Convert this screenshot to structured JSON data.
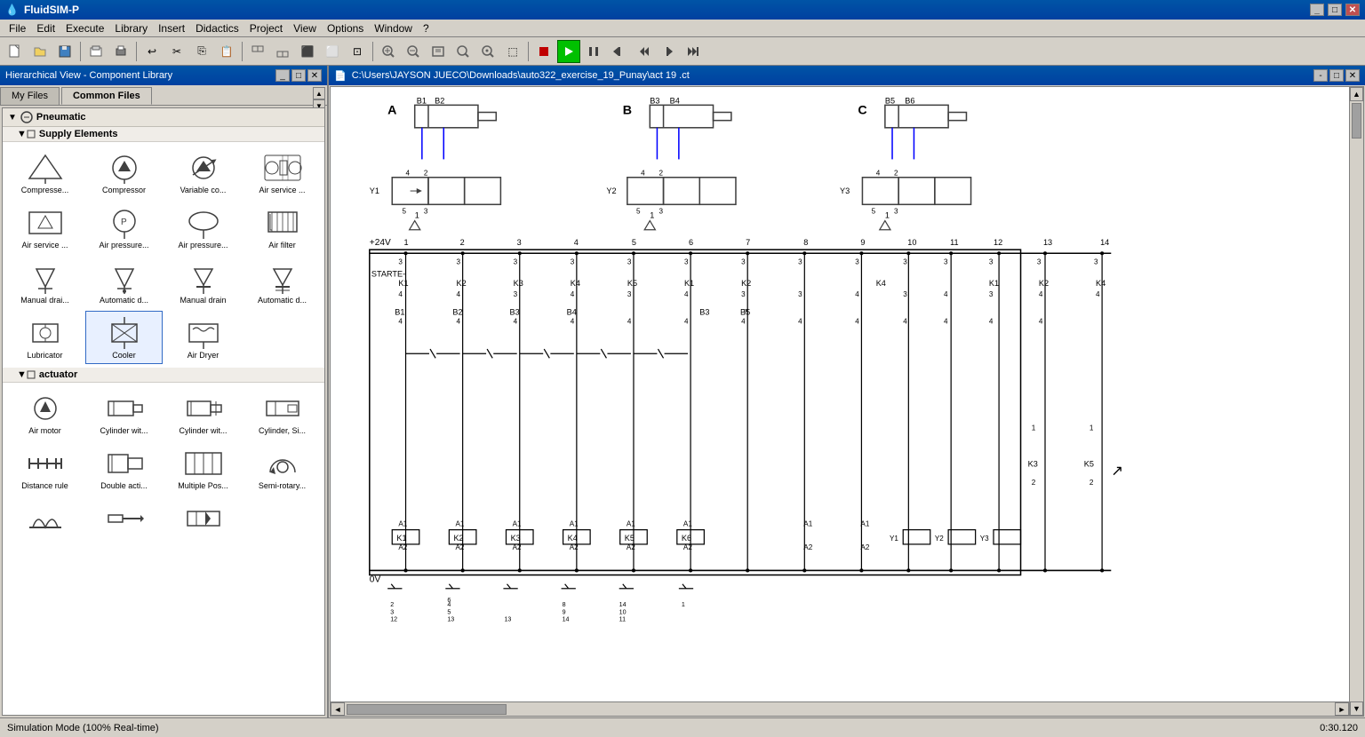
{
  "titleBar": {
    "title": "FluidSIM-P",
    "icon": "🔵",
    "controls": [
      "_",
      "□",
      "✕"
    ]
  },
  "menuBar": {
    "items": [
      "File",
      "Edit",
      "Execute",
      "Library",
      "Insert",
      "Didactics",
      "Project",
      "View",
      "Options",
      "Window",
      "?"
    ]
  },
  "toolbar": {
    "buttons": [
      {
        "name": "new",
        "icon": "📄"
      },
      {
        "name": "open",
        "icon": "📂"
      },
      {
        "name": "save",
        "icon": "💾"
      },
      {
        "name": "print-preview",
        "icon": "🖨"
      },
      {
        "name": "print",
        "icon": "🖨"
      },
      {
        "name": "undo",
        "icon": "↩"
      },
      {
        "name": "cut",
        "icon": "✂"
      },
      {
        "name": "copy",
        "icon": "⎘"
      },
      {
        "name": "paste",
        "icon": "📋"
      },
      {
        "name": "align-left",
        "icon": "⬛"
      },
      {
        "name": "align-center",
        "icon": "⬛"
      },
      {
        "name": "align-right",
        "icon": "⬛"
      },
      {
        "name": "align-top",
        "icon": "⬛"
      },
      {
        "name": "align-bottom",
        "icon": "⬛"
      },
      {
        "name": "zoom-in",
        "icon": "🔍"
      },
      {
        "name": "zoom-out",
        "icon": "🔍"
      },
      {
        "name": "zoom-fit",
        "icon": "⊞"
      },
      {
        "name": "zoom-actual",
        "icon": "⊡"
      },
      {
        "name": "stop",
        "icon": "⬛"
      },
      {
        "name": "play",
        "icon": "▶"
      },
      {
        "name": "pause",
        "icon": "⏸"
      },
      {
        "name": "step-back",
        "icon": "⏮"
      },
      {
        "name": "step-back2",
        "icon": "⏭"
      },
      {
        "name": "step-fwd",
        "icon": "⏭"
      },
      {
        "name": "fast-fwd",
        "icon": "⏭"
      }
    ]
  },
  "leftPanel": {
    "title": "Hierarchical View - Component Library",
    "tabs": [
      {
        "label": "My Files",
        "active": false
      },
      {
        "label": "Common Files",
        "active": true
      }
    ],
    "sections": [
      {
        "name": "Pneumatic",
        "expanded": true,
        "subsections": [
          {
            "name": "Supply Elements",
            "expanded": true,
            "components": [
              {
                "label": "Compresse...",
                "icon": "compressor-triangle"
              },
              {
                "label": "Compressor",
                "icon": "compressor-circle"
              },
              {
                "label": "Variable co...",
                "icon": "variable-comp"
              },
              {
                "label": "Air service ...",
                "icon": "air-service-combo"
              },
              {
                "label": "Air service ...",
                "icon": "air-service-rect"
              },
              {
                "label": "Air pressure...",
                "icon": "air-pressure-circle"
              },
              {
                "label": "Air pressure...",
                "icon": "air-pressure-oval"
              },
              {
                "label": "Air filter",
                "icon": "air-filter"
              },
              {
                "label": "Manual drai...",
                "icon": "manual-drain"
              },
              {
                "label": "Automatic d...",
                "icon": "auto-drain"
              },
              {
                "label": "Manual drain",
                "icon": "manual-drain2"
              },
              {
                "label": "Automatic d...",
                "icon": "auto-drain2"
              },
              {
                "label": "Lubricator",
                "icon": "lubricator"
              },
              {
                "label": "Cooler",
                "icon": "cooler"
              },
              {
                "label": "Air Dryer",
                "icon": "air-dryer"
              }
            ]
          },
          {
            "name": "actuator",
            "expanded": true,
            "components": [
              {
                "label": "Air motor",
                "icon": "air-motor"
              },
              {
                "label": "Cylinder wit...",
                "icon": "cylinder1"
              },
              {
                "label": "Cylinder wit...",
                "icon": "cylinder2"
              },
              {
                "label": "Cylinder, Si...",
                "icon": "cylinder3"
              },
              {
                "label": "Distance rule",
                "icon": "distance-rule"
              },
              {
                "label": "Double acti...",
                "icon": "double-acting"
              },
              {
                "label": "Multiple Pos...",
                "icon": "multiple-pos"
              },
              {
                "label": "Semi-rotary...",
                "icon": "semi-rotary"
              },
              {
                "label": "",
                "icon": "bellows"
              },
              {
                "label": "",
                "icon": "actuator2"
              },
              {
                "label": "",
                "icon": "actuator3"
              }
            ]
          }
        ]
      }
    ]
  },
  "canvas": {
    "title": "C:\\Users\\JAYSON JUECO\\Downloads\\auto322_exercise_19_Punay\\act 19 .ct",
    "controls": [
      "-",
      "□",
      "✕"
    ]
  },
  "statusBar": {
    "mode": "Simulation Mode (100% Real-time)",
    "time": "0:30.120"
  },
  "diagram": {
    "labels": {
      "A": "A",
      "B": "B",
      "C": "C",
      "Y1": "Y1",
      "Y2": "Y2",
      "Y3": "Y3",
      "plus24V": "+24V",
      "zero": "0V",
      "starter": "STARTE-",
      "coils": [
        "K1",
        "K2",
        "K3",
        "K4",
        "K5",
        "K1",
        "K2",
        "K4"
      ],
      "contacts": [
        "B1",
        "B2",
        "B3",
        "B4",
        "B5",
        "B6"
      ],
      "relays": [
        "K1",
        "K2",
        "K3",
        "K4",
        "K5",
        "K6"
      ],
      "valves": [
        "Y1",
        "Y2",
        "Y3"
      ]
    }
  }
}
